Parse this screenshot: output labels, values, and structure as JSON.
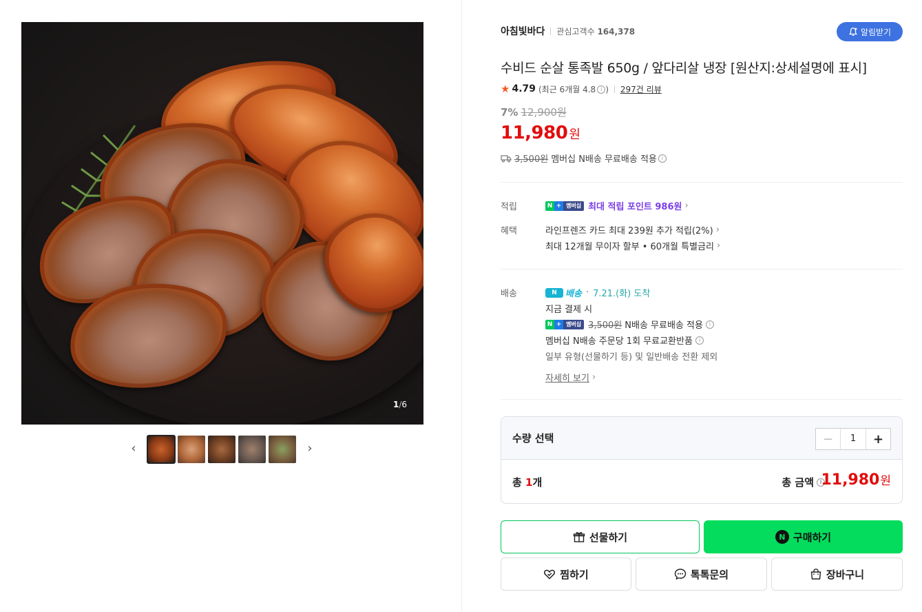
{
  "gallery": {
    "counter_current": "1",
    "counter_sep": "/",
    "counter_total": "6",
    "thumbnails": [
      "thumb-1",
      "thumb-2",
      "thumb-3",
      "thumb-4",
      "thumb-5"
    ]
  },
  "store": {
    "name": "아침빛바다",
    "fans_label": "관심고객수",
    "fans_count": "164,378",
    "alarm_label": "알림받기"
  },
  "product": {
    "title": "수비드 순살 통족발 650g / 앞다리살 냉장 [원산지:상세설명에 표시]",
    "rating": "4.79",
    "rating_recent": "(최근 6개월 4.8",
    "rating_recent_close": ")",
    "reviews": "297건 리뷰",
    "discount_pct": "7%",
    "original_price": "12,900원",
    "price": "11,980",
    "price_unit": "원",
    "ship_fee": "3,500원",
    "ship_text": "멤버십 N배송 무료배송 적용"
  },
  "benefits": {
    "points_label": "적립",
    "points_text": "최대 적립 포인트 986원",
    "benefit_label": "혜택",
    "benefit_card": "라인프렌즈 카드 최대 239원 추가 적립(2%)",
    "benefit_installment": "최대 12개월 무이자 할부 • 60개월 특별금리"
  },
  "delivery": {
    "label": "배송",
    "nship": "배송",
    "arrival": "7.21.(화) 도착",
    "pay_now": "지금 결제 시",
    "fee_strike": "3,500원",
    "fee_text": "N배송 무료배송 적용",
    "exchange": "멤버십 N배송 주문당 1회 무료교환반품",
    "exclude": "일부 유형(선물하기 등) 및 일반배송 전환 제외",
    "detail_link": "자세히 보기"
  },
  "badge": {
    "n": "N",
    "plus": "+",
    "mem": "멤버십"
  },
  "quantity": {
    "label": "수량 선택",
    "value": "1",
    "total_prefix": "총 ",
    "total_count": "1",
    "total_suffix": "개",
    "sum_label": "총 금액",
    "sum_value": "11,980",
    "sum_unit": "원"
  },
  "actions": {
    "gift": "선물하기",
    "buy": "구매하기",
    "wish": "찜하기",
    "talk": "톡톡문의",
    "cart": "장바구니"
  },
  "colors": {
    "price_red": "#e10d0d",
    "naver_green": "#03c75a",
    "alarm_blue": "#3d72e0",
    "points_purple": "#7a3fe8"
  }
}
